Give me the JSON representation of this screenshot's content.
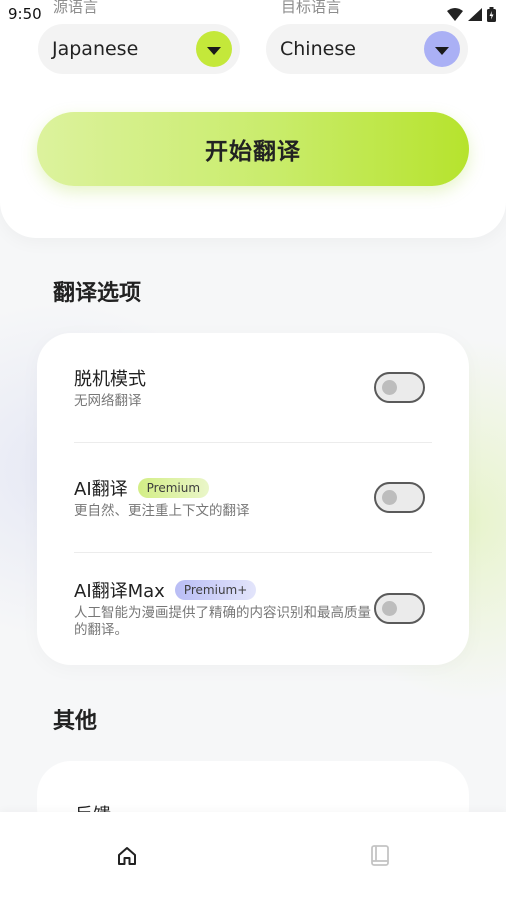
{
  "status_bar": {
    "time": "9:50",
    "icons": [
      "wifi-icon",
      "signal-icon",
      "battery-icon"
    ]
  },
  "language": {
    "source_label": "源语言",
    "source_value": "Japanese",
    "target_label": "目标语言",
    "target_value": "Chinese",
    "source_button_color": "#c4e83a",
    "target_button_color": "#aab0f5"
  },
  "start_button": {
    "label": "开始翻译"
  },
  "translation_options": {
    "title": "翻译选项",
    "items": [
      {
        "title": "脱机模式",
        "description": "无网络翻译",
        "badge": "",
        "enabled": false
      },
      {
        "title": "AI翻译",
        "description": "更自然、更注重上下文的翻译",
        "badge": "Premium",
        "enabled": false
      },
      {
        "title": "AI翻译Max",
        "description": "人工智能为漫画提供了精确的内容识别和最高质量的翻译。",
        "badge": "Premium+",
        "enabled": false
      }
    ]
  },
  "other": {
    "title": "其他",
    "items": [
      {
        "label": "反馈"
      }
    ]
  },
  "bottom_nav": {
    "items": [
      {
        "icon": "home-icon",
        "active": true
      },
      {
        "icon": "book-icon",
        "active": false
      }
    ]
  },
  "colors": {
    "accent_green": "#b6e32d",
    "accent_purple": "#aab0f5",
    "premium_badge": "#d6f08a",
    "premium_plus_badge": "#c9ccf7"
  }
}
